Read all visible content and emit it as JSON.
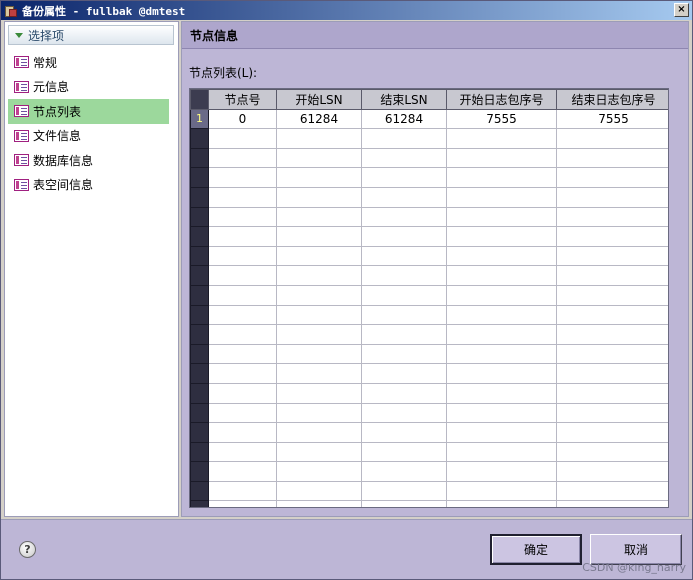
{
  "window": {
    "title": "备份属性 - fullbak @dmtest",
    "close_glyph": "×"
  },
  "options": {
    "header": "选择项",
    "items": [
      {
        "label": "常规"
      },
      {
        "label": "元信息"
      },
      {
        "label": "节点列表"
      },
      {
        "label": "文件信息"
      },
      {
        "label": "数据库信息"
      },
      {
        "label": "表空间信息"
      }
    ],
    "selected_index": 2
  },
  "main": {
    "section_title": "节点信息",
    "list_label": "节点列表(L):",
    "columns": [
      "节点号",
      "开始LSN",
      "结束LSN",
      "开始日志包序号",
      "结束日志包序号"
    ],
    "rows": [
      [
        "0",
        "61284",
        "61284",
        "7555",
        "7555"
      ]
    ],
    "first_row_number": "1"
  },
  "footer": {
    "help_glyph": "?",
    "ok_label": "确定",
    "cancel_label": "取消",
    "watermark": "CSDN @king_harry"
  },
  "colors": {
    "selection": "#9cd89c",
    "panel": "#bdb6d6",
    "title_start": "#0a246a"
  }
}
